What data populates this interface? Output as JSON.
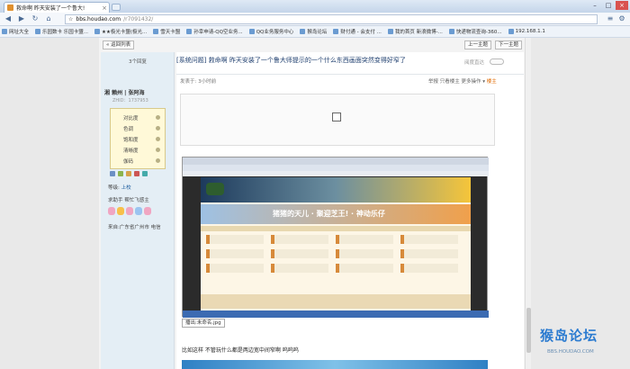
{
  "browser": {
    "tab_title": "救命啊 昨天安装了一个鲁大!",
    "tab_close": "×",
    "win_min": "–",
    "win_max": "□",
    "win_close": "×",
    "address_host": "bbs.houdao.com",
    "address_path": "/r7091432/",
    "bookmarks": [
      "网址大全",
      "乐园数卡 乐园卡盟...",
      "★★极光卡盟(极光...",
      "雪天卡盟",
      "孙幸申请-QQ空业务...",
      "QQ业务服务中心",
      "猴岛论坛",
      "财付通 - 会支付 ...",
      "我的首页 新浪微博-...",
      "快递物流查询-360...",
      "192.168.1.1"
    ]
  },
  "page": {
    "back_list": "« 返回列表",
    "prev_topic": "上一主题",
    "next_topic": "下一主题",
    "reply_count": "3个回复",
    "user_name": "湘 赖州 | 张阿海",
    "user_id": "ZHID：1737953",
    "rating_rows": [
      "对比度",
      "色调",
      "饱和度",
      "清晰度",
      "伽码"
    ],
    "grade_label": "等级:",
    "grade_value": "上校",
    "user_desc": "求助手 帮忙飞感主",
    "user_location": "来自:广东省广州市 电信",
    "post_title": "[系统问题] 救命啊 昨天安装了一个鲁大师提示的一个什么东西画面突然变得好窄了",
    "view_mode": "阅度直达",
    "post_meta": "发表于: 3小时前",
    "action_1": "举报",
    "action_2": "只看楼主",
    "action_3": "更多操作 ▾",
    "action_4": "楼主",
    "screenshot_inner_banner": "猪猪的天儿 · 聚迎芝王! · 神动乐仔",
    "attach_caption": "播出:未命名.jpg",
    "post_text": "比如这样 不管玩什么都是两边宽中间窄啊 呜呜呜",
    "watermark_main": "猴岛论坛",
    "watermark_sub": "BBS.HOUDAO.COM"
  },
  "colors": {
    "accent": "#1f3f6f",
    "hot": "#e06a00",
    "close_red": "#d9534f"
  }
}
